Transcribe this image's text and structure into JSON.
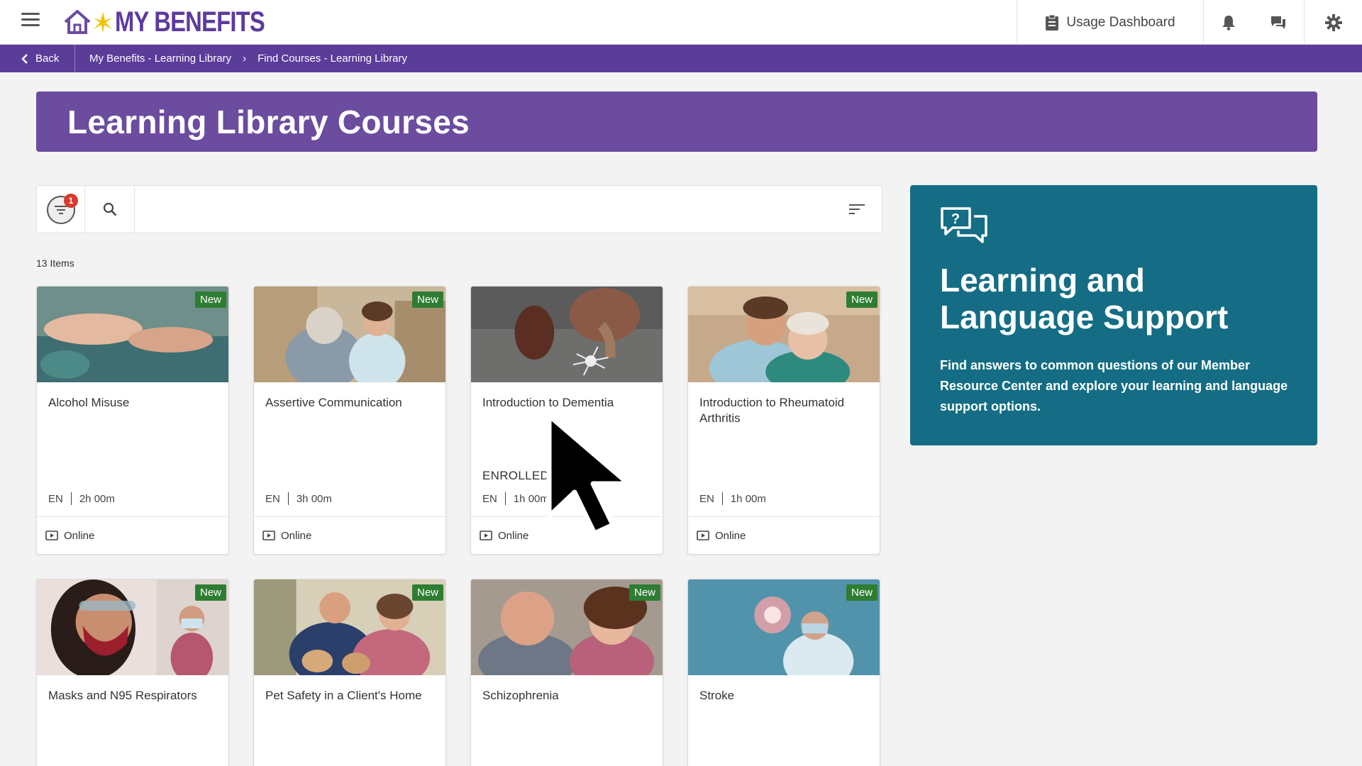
{
  "header": {
    "brand": "MY BENEFITS",
    "usage_label": "Usage Dashboard"
  },
  "breadcrumb": {
    "back_label": "Back",
    "crumb1": "My Benefits - Learning Library",
    "crumb2": "Find Courses - Learning Library"
  },
  "banner": {
    "title": "Learning Library Courses"
  },
  "search": {
    "placeholder": "",
    "filter_count": "1"
  },
  "results": {
    "count_label": "13 Items"
  },
  "cards": [
    {
      "title": "Alcohol Misuse",
      "badge": "New",
      "lang": "EN",
      "duration": "2h 00m",
      "mode": "Online",
      "enrolled": ""
    },
    {
      "title": "Assertive Communication",
      "badge": "New",
      "lang": "EN",
      "duration": "3h 00m",
      "mode": "Online",
      "enrolled": ""
    },
    {
      "title": "Introduction to Dementia",
      "badge": "",
      "lang": "EN",
      "duration": "1h 00m",
      "mode": "Online",
      "enrolled": "ENROLLED"
    },
    {
      "title": "Introduction to Rheumatoid Arthritis",
      "badge": "New",
      "lang": "EN",
      "duration": "1h 00m",
      "mode": "Online",
      "enrolled": ""
    },
    {
      "title": "Masks and N95 Respirators",
      "badge": "New"
    },
    {
      "title": "Pet Safety in a Client's Home",
      "badge": "New"
    },
    {
      "title": "Schizophrenia",
      "badge": "New"
    },
    {
      "title": "Stroke",
      "badge": "New"
    }
  ],
  "support": {
    "title_line1": "Learning and",
    "title_line2": "Language Support",
    "description": "Find answers to common questions of our Member Resource Center and explore your learning and language support options."
  },
  "colors": {
    "brand_purple": "#5b3c99",
    "banner_purple": "#6b4c9f",
    "support_teal": "#146d84",
    "new_badge": "#2e7d32"
  }
}
